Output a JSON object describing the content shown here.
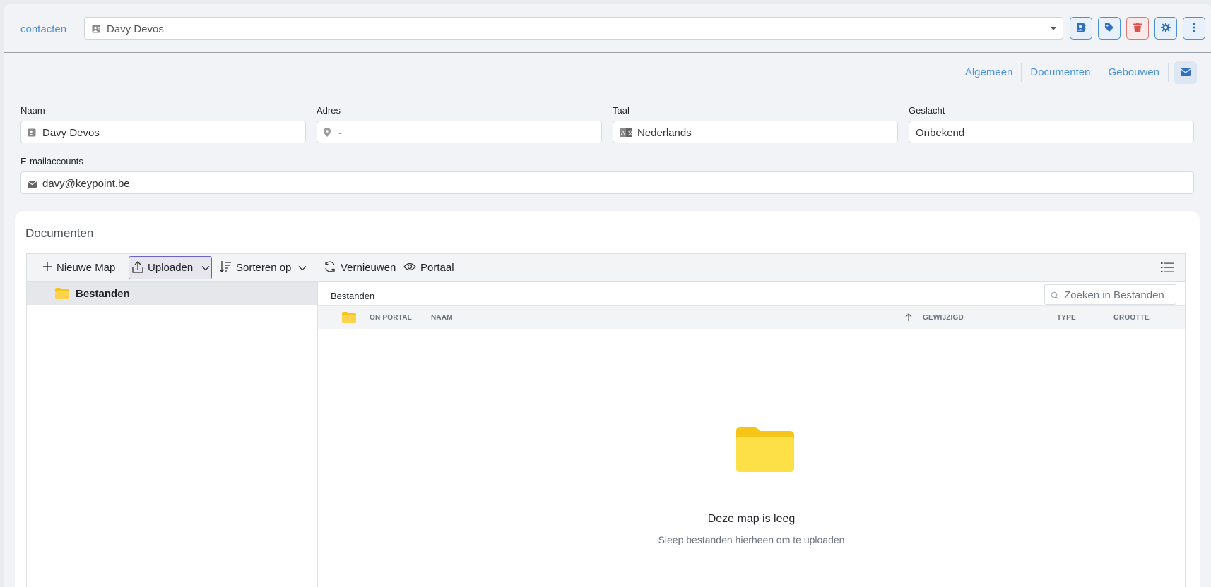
{
  "breadcrumb": {
    "label": "contacten"
  },
  "contact_select": {
    "value": "Davy Devos"
  },
  "colors": {
    "accent": "#4a90d9",
    "danger": "#e07676",
    "folder": "#fcd34d",
    "folder_dark": "#f5c518"
  },
  "toolbar_icons": [
    "address-card-icon",
    "tag-icon",
    "trash-icon",
    "gear-icon",
    "more-vertical-icon"
  ],
  "tabs": [
    {
      "label": "Algemeen"
    },
    {
      "label": "Documenten"
    },
    {
      "label": "Gebouwen"
    }
  ],
  "form": {
    "naam": {
      "label": "Naam",
      "value": "Davy Devos"
    },
    "adres": {
      "label": "Adres",
      "value": "-"
    },
    "taal": {
      "label": "Taal",
      "value": "Nederlands"
    },
    "geslacht": {
      "label": "Geslacht",
      "value": "Onbekend"
    },
    "email": {
      "label": "E-mailaccounts",
      "value": "davy@keypoint.be"
    }
  },
  "documents": {
    "title": "Documenten",
    "toolbar": {
      "new_folder": "Nieuwe Map",
      "upload": "Uploaden",
      "sort": "Sorteren op",
      "refresh": "Vernieuwen",
      "portal": "Portaal"
    },
    "tree": [
      {
        "label": "Bestanden"
      }
    ],
    "path": "Bestanden",
    "search_placeholder": "Zoeken in Bestanden",
    "columns": {
      "on_portal": "ON PORTAL",
      "name": "NAAM",
      "modified": "GEWIJZIGD",
      "type": "TYPE",
      "size": "GROOTTE"
    },
    "empty_title": "Deze map is leeg",
    "empty_subtitle": "Sleep bestanden hierheen om te uploaden"
  }
}
